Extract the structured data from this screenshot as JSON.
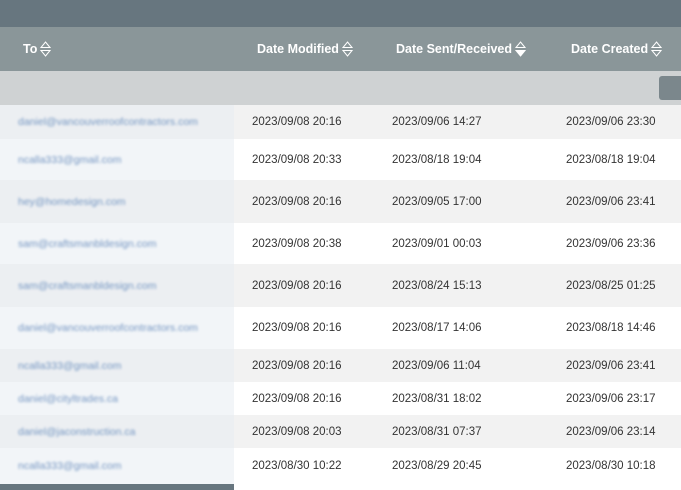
{
  "columns": {
    "to": "To",
    "date_modified": "Date Modified",
    "date_sent_received": "Date Sent/Received",
    "date_created": "Date Created"
  },
  "rows": [
    {
      "to": "daniel@vancouverroofcontractors.com",
      "modified": "2023/09/08 20:16",
      "sent": "2023/09/06 14:27",
      "created": "2023/09/06 23:30"
    },
    {
      "to": "ncalla333@gmail.com",
      "modified": "2023/09/08 20:33",
      "sent": "2023/08/18 19:04",
      "created": "2023/08/18 19:04"
    },
    {
      "to": "hey@homedesign.com",
      "modified": "2023/09/08 20:16",
      "sent": "2023/09/05 17:00",
      "created": "2023/09/06 23:41"
    },
    {
      "to": "sam@craftsmanbldesign.com",
      "modified": "2023/09/08 20:38",
      "sent": "2023/09/01 00:03",
      "created": "2023/09/06 23:36"
    },
    {
      "to": "sam@craftsmanbldesign.com",
      "modified": "2023/09/08 20:16",
      "sent": "2023/08/24 15:13",
      "created": "2023/08/25 01:25"
    },
    {
      "to": "daniel@vancouverroofcontractors.com",
      "modified": "2023/09/08 20:16",
      "sent": "2023/08/17 14:06",
      "created": "2023/08/18 14:46"
    },
    {
      "to": "ncalla333@gmail.com",
      "modified": "2023/09/08 20:16",
      "sent": "2023/09/06 11:04",
      "created": "2023/09/06 23:41"
    },
    {
      "to": "daniel@cityltrades.ca",
      "modified": "2023/09/08 20:16",
      "sent": "2023/08/31 18:02",
      "created": "2023/09/06 23:17"
    },
    {
      "to": "daniel@jaconstruction.ca",
      "modified": "2023/09/08 20:03",
      "sent": "2023/08/31 07:37",
      "created": "2023/09/06 23:14"
    },
    {
      "to": "ncalla333@gmail.com",
      "modified": "2023/08/30 10:22",
      "sent": "2023/08/29 20:45",
      "created": "2023/08/30 10:18"
    }
  ]
}
